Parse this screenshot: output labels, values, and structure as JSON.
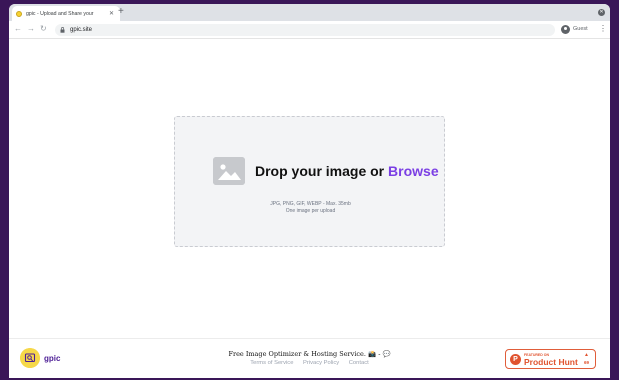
{
  "browser": {
    "tab_title": "gpic - Upload and Share your",
    "tab_close": "✕",
    "new_tab": "+",
    "url": "gpic.site",
    "profile_label": "Guest",
    "back": "←",
    "forward": "→",
    "reload": "↻",
    "menu": "⋮",
    "window_close": "✕"
  },
  "dropzone": {
    "headline_prefix": "Drop your image or ",
    "browse_label": "Browse",
    "formats": "JPG, PNG, GIF, WEBP - Max. 35mb",
    "limit": "One image per upload"
  },
  "footer": {
    "logo_text": "gpic",
    "tagline": "Free Image Optimizer & Hosting Service. 📸 - 💬",
    "links": [
      "Terms of Service",
      "Privacy Policy",
      "Contact"
    ],
    "product_hunt": {
      "featured": "FEATURED ON",
      "name": "Product Hunt",
      "logo_letter": "P",
      "arrow": "▲",
      "count": "69"
    }
  },
  "colors": {
    "accent": "#7b3fe4",
    "background": "#3a1658",
    "product_hunt": "#e0532f"
  }
}
